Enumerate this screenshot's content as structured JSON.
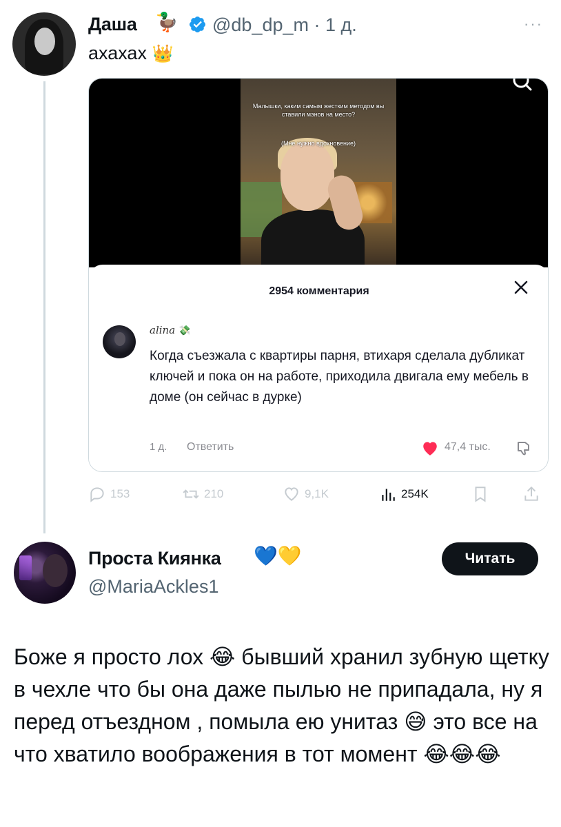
{
  "tweet1": {
    "name": "Даша",
    "name_emoji": "🦆",
    "handle_time": "@db_dp_m · 1 д.",
    "more": "···",
    "text": "ахахах",
    "text_emoji": "👑",
    "media": {
      "video_caption_1": "Малышки, каким самым жестким методом вы ставили мэнов на место?",
      "video_caption_2": "(Мне нужно вдохновение)",
      "sheet_title": "2954 комментария",
      "comment": {
        "author": "alina",
        "author_emoji": "💸",
        "text": "Когда съезжала с квартиры парня, втихаря сделала дубликат ключей и пока он на работе, приходила двигала ему мебель в доме (он сейчас в дурке)",
        "time": "1 д.",
        "reply": "Ответить",
        "likes": "47,4 тыс."
      }
    },
    "actions": {
      "replies": "153",
      "retweets": "210",
      "likes": "9,1K",
      "views": "254K"
    }
  },
  "tweet2": {
    "name": "Проста Киянка",
    "name_emojis": "💙💛",
    "handle": "@MariaAckles1",
    "follow_label": "Читать",
    "text": "Боже я просто лох 😂 бывший хранил зубную щетку в чехле что бы она даже пылью не припадала, ну я перед отъездном , помыла ею унитаз 😅 это все на что хватило воображения в тот момент 😂😂😂"
  },
  "colors": {
    "verified": "#1d9bf0",
    "text": "#0f1419",
    "secondary": "#536471",
    "like_heart": "#fe2c55"
  }
}
